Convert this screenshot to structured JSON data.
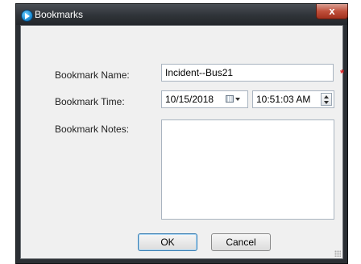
{
  "window": {
    "title": "Bookmarks",
    "close_label": "x"
  },
  "form": {
    "name_label": "Bookmark Name:",
    "name_value": "Incident--Bus21",
    "required_marker": "*",
    "time_label": "Bookmark Time:",
    "date_value": "10/15/2018",
    "time_value": "10:51:03 AM",
    "notes_label": "Bookmark Notes:",
    "notes_value": ""
  },
  "buttons": {
    "ok_label": "OK",
    "cancel_label": "Cancel"
  },
  "colors": {
    "required": "#e02020",
    "title_bar": "#2f3338",
    "close_button": "#c0503b"
  },
  "icons": {
    "app": "bookmarks-app-icon",
    "calendar": "calendar-dropdown-icon",
    "spinner": "time-spinner-icon"
  }
}
